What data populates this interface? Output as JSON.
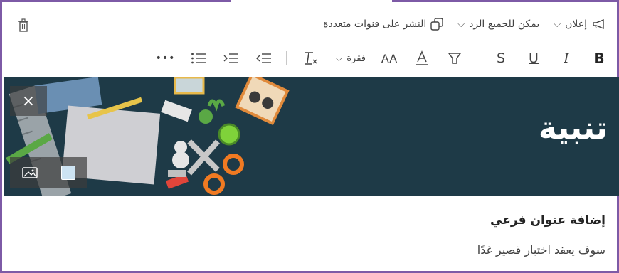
{
  "toolbar_top": {
    "post_type_label": "إعلان",
    "reply_label": "يمكن للجميع الرد",
    "multichannel_label": "النشر على قنوات متعددة"
  },
  "toolbar_format": {
    "bold": "B",
    "italic": "I",
    "underline": "U",
    "strike": "S",
    "font_size": "AA",
    "paragraph_label": "فقرة",
    "more": "•••"
  },
  "banner": {
    "title": "تنبية",
    "close": "×",
    "background_color": "#1e3a47"
  },
  "content": {
    "subtitle": "إضافة عنوان فرعي",
    "body": "سوف يعقد اختبار قصير غدًا"
  },
  "colors": {
    "accent": "#7d5aa6"
  }
}
